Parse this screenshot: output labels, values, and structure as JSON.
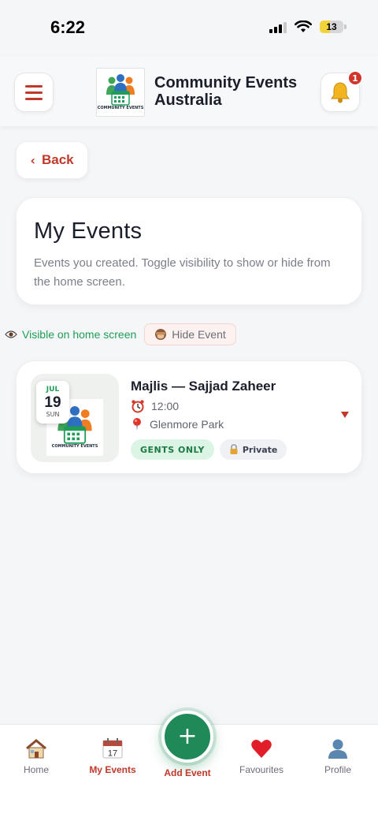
{
  "status_bar": {
    "time": "6:22",
    "battery": "13"
  },
  "header": {
    "app_title": "Community Events Australia",
    "logo_caption": "COMMUNITY EVENTS",
    "notification_count": "1"
  },
  "back_label": "Back",
  "intro": {
    "title": "My Events",
    "description": "Events you created. Toggle visibility to show or hide from the home screen."
  },
  "visibility": {
    "status": "Visible on home screen",
    "toggle_label": "Hide Event"
  },
  "event": {
    "month": "JUL",
    "day": "19",
    "weekday": "SUN",
    "title": "Majlis — Sajjad Zaheer",
    "time": "12:00",
    "location": "Glenmore Park",
    "tag_audience": "GENTS ONLY",
    "tag_privacy": "Private",
    "logo_caption": "COMMUNITY EVENTS"
  },
  "nav": {
    "items": [
      {
        "label": "Home",
        "icon": "house-icon"
      },
      {
        "label": "My Events",
        "icon": "calendar-icon",
        "calendar_day": "17"
      },
      {
        "label": "Add Event",
        "icon": "plus-icon"
      },
      {
        "label": "Favourites",
        "icon": "heart-icon"
      },
      {
        "label": "Profile",
        "icon": "person-icon"
      }
    ],
    "active": "My Events"
  },
  "colors": {
    "accent_red": "#c0392b",
    "accent_green": "#1f8a57",
    "background": "#f5f6f8"
  }
}
